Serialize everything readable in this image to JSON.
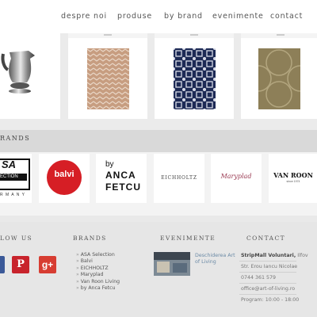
{
  "nav": {
    "items": [
      "despre noi",
      "produse",
      "by brand",
      "evenimente",
      "contact"
    ]
  },
  "sections": {
    "brands_title": "RANDS"
  },
  "brand_logos": {
    "asa_top": "SA",
    "asa_bottom": "ECTION",
    "asa_country": "R M A N Y",
    "balvi": "balvi",
    "balvi_sub": "",
    "anca_by": "by",
    "anca_line1": "ANCA",
    "anca_line2": "FETCU",
    "eichholtz": "EICHHOLTZ",
    "maryplad": "Maryplad",
    "vanroon": "VAN ROON",
    "vanroon_sub": "since 1974"
  },
  "footer": {
    "follow_title": "LOW US",
    "brands_title": "BRANDS",
    "events_title": "EVENIMENTE",
    "contact_title": "CONTACT",
    "social": {
      "pinterest": "P",
      "gplus": "g+"
    },
    "brands_list": [
      "ASA Selection",
      "Balvi",
      "EICHHOLTZ",
      "Maryplad",
      "Van Roon Living",
      "by Anca Fetcu"
    ],
    "event_title": "Deschiderea Art of Living",
    "contact": {
      "line1_bold": "StripMall Voluntari,",
      "line1_rest": " Ilfov",
      "line2": "Str. Erou Iancu Nicolae",
      "phone": "0744 361 579",
      "email": "office@art-of-living.ro",
      "hours": "Program: 10:00 - 18:00"
    }
  },
  "colors": {
    "pinterest": "#c8232c",
    "gplus": "#d73d32",
    "facebook": "#3b5998",
    "balvi": "#d61e25",
    "link": "#6b8aa6"
  }
}
